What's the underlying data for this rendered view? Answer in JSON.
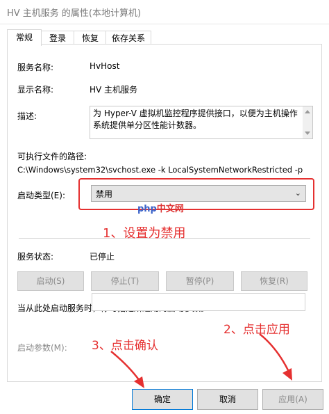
{
  "window": {
    "title": "HV 主机服务 的属性(本地计算机)"
  },
  "tabs": [
    {
      "label": "常规"
    },
    {
      "label": "登录"
    },
    {
      "label": "恢复"
    },
    {
      "label": "依存关系"
    }
  ],
  "general": {
    "service_name_label": "服务名称:",
    "service_name_value": "HvHost",
    "display_name_label": "显示名称:",
    "display_name_value": "HV 主机服务",
    "description_label": "描述:",
    "description_value": "为 Hyper-V 虚拟机监控程序提供接口，以便为主机操作系统提供单分区性能计数器。",
    "path_label": "可执行文件的路径:",
    "path_value": "C:\\Windows\\system32\\svchost.exe -k LocalSystemNetworkRestricted -p",
    "startup_type_label": "启动类型(E):",
    "startup_type_value": "禁用",
    "status_label": "服务状态:",
    "status_value": "已停止",
    "buttons": {
      "start": "启动(S)",
      "stop": "停止(T)",
      "pause": "暂停(P)",
      "resume": "恢复(R)"
    },
    "hint": "当从此处启动服务时，你可指定所适用的启动参数。",
    "params_label": "启动参数(M):"
  },
  "footer": {
    "ok": "确定",
    "cancel": "取消",
    "apply": "应用(A)"
  },
  "annotations": {
    "step1": "1、设置为禁用",
    "step2": "2、点击应用",
    "step3": "3、点击确认",
    "watermark_php": "php",
    "watermark_cn": "中文网"
  },
  "colors": {
    "annotation_red": "#e53030",
    "focus_blue": "#0078d7"
  }
}
